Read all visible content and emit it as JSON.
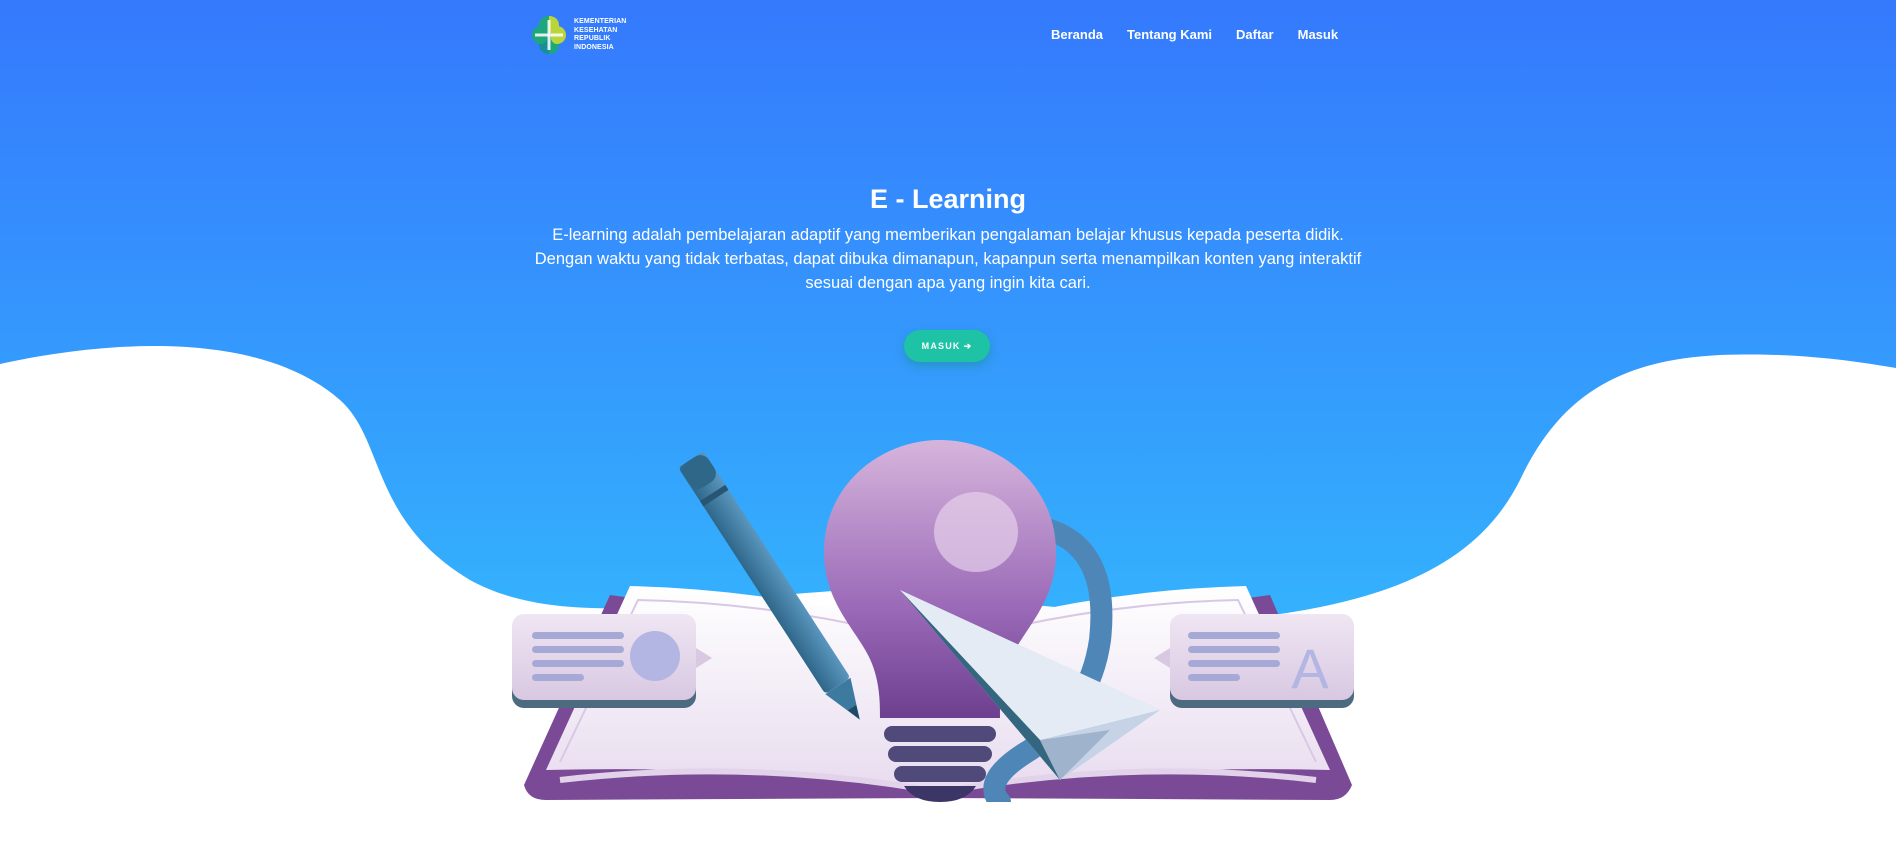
{
  "brand": {
    "logo_lines": [
      "KEMENTERIAN",
      "KESEHATAN",
      "REPUBLIK",
      "INDONESIA"
    ]
  },
  "nav": {
    "items": [
      {
        "label": "Beranda"
      },
      {
        "label": "Tentang Kami"
      },
      {
        "label": "Daftar"
      },
      {
        "label": "Masuk"
      }
    ]
  },
  "hero": {
    "title": "E - Learning",
    "description": "E-learning adalah pembelajaran adaptif yang memberikan pengalaman belajar khusus kepada peserta didik. Dengan waktu yang tidak terbatas, dapat dibuka dimanapun, kapanpun serta menampilkan konten yang interaktif sesuai dengan apa yang ingin kita cari.",
    "cta_label": "MASUK",
    "cta_icon": "arrow-right-icon"
  },
  "illustration": {
    "right_card_letter": "A"
  },
  "colors": {
    "gradient_top": "#3579fd",
    "gradient_bottom": "#34c4fd",
    "cta": "#1dc3a4",
    "book_cover": "#7a4a96",
    "bulb": "#9b6ab8",
    "pencil": "#3c7aa0"
  }
}
